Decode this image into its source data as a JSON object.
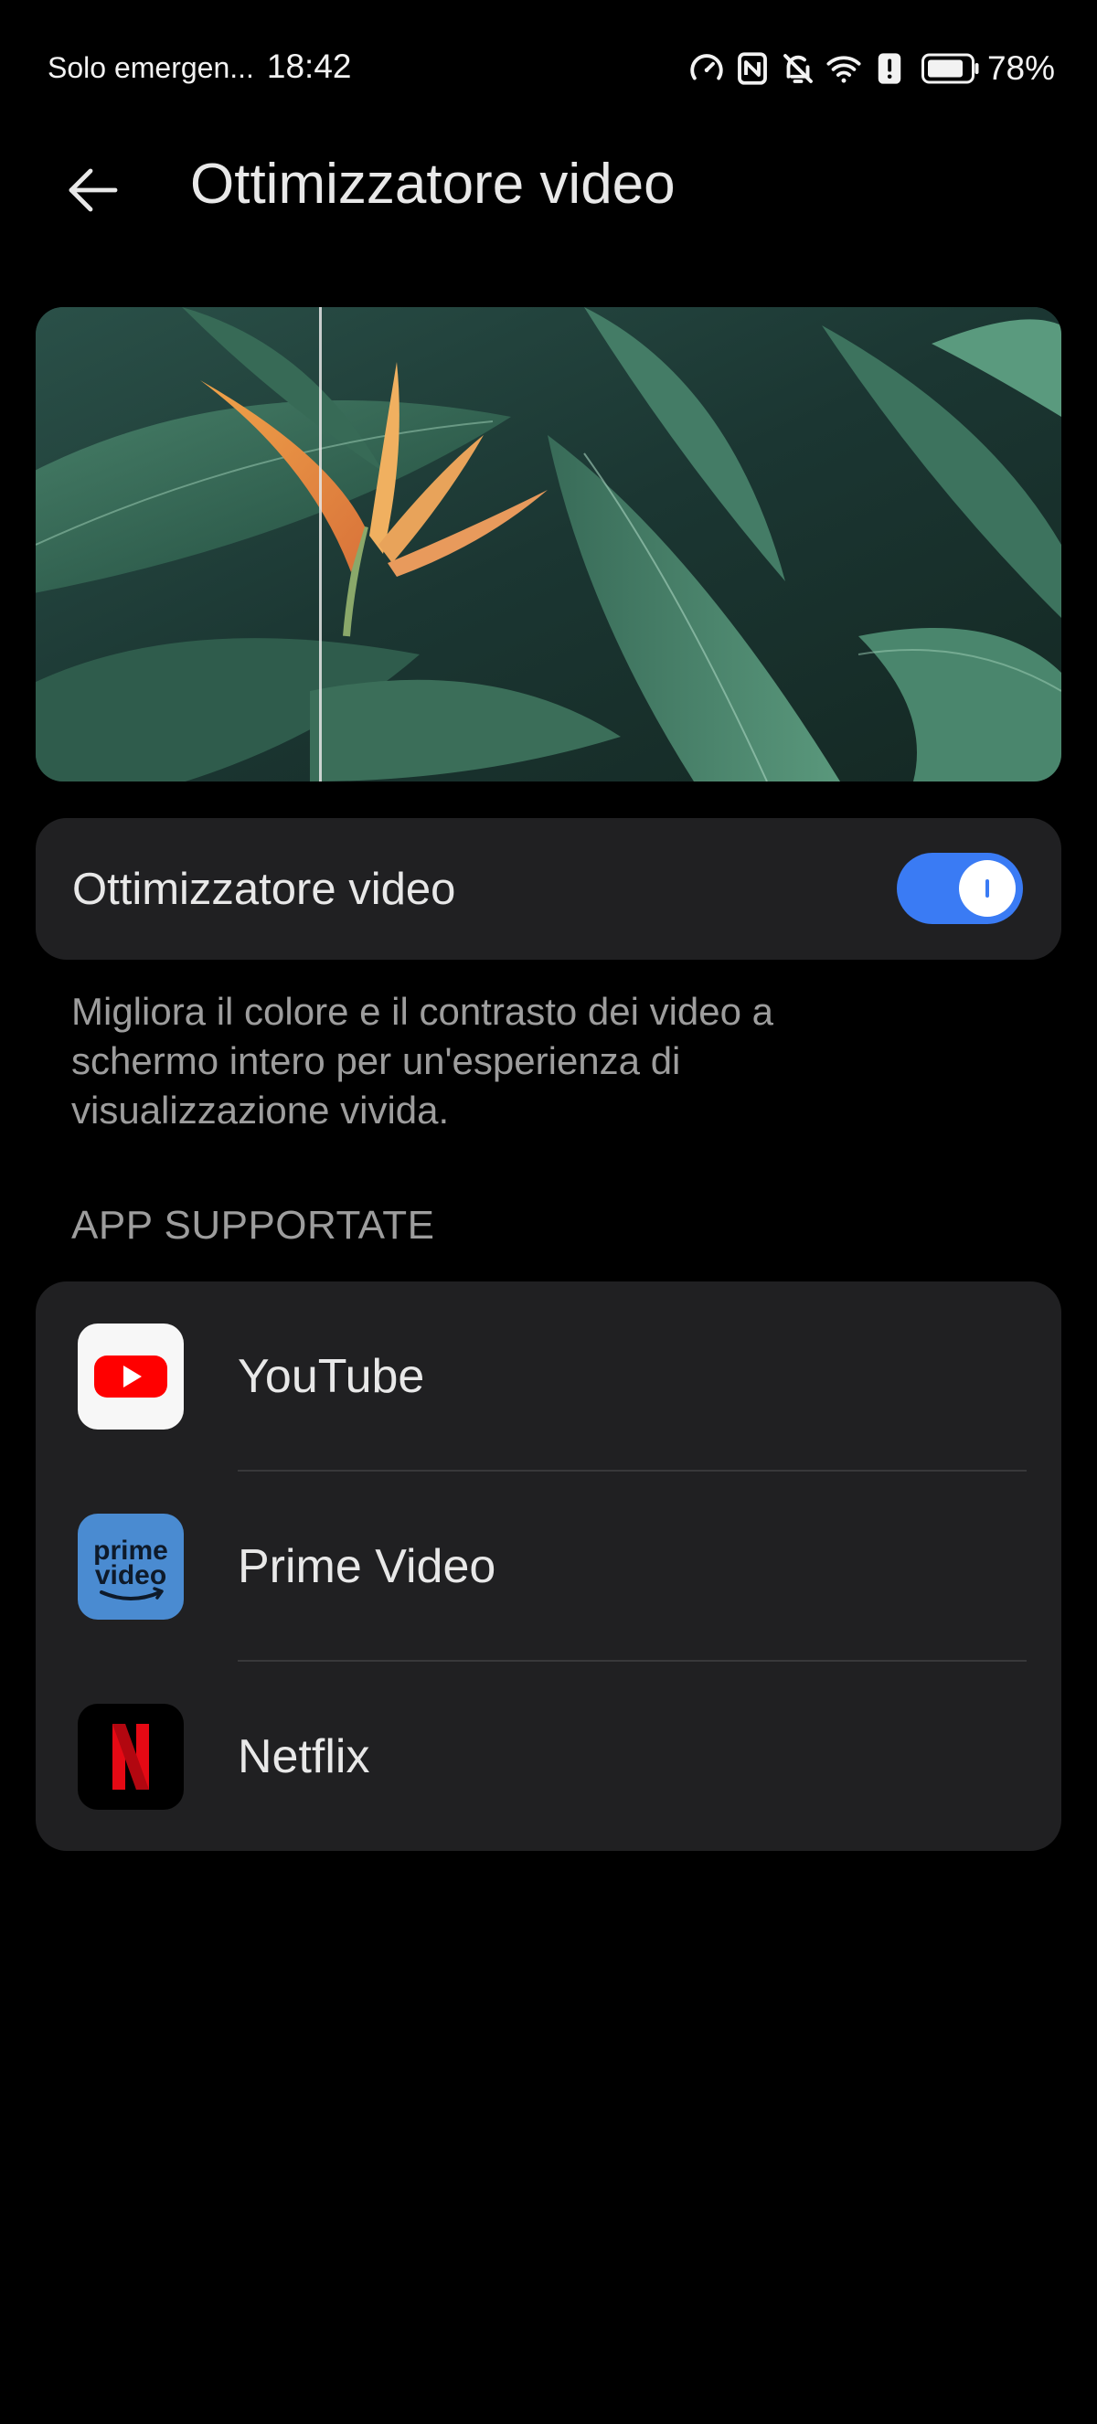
{
  "status_bar": {
    "carrier": "Solo emergen...",
    "time": "18:42",
    "battery_percent": "78%",
    "battery_level": 0.78,
    "icons": [
      "speed-icon",
      "nfc-icon",
      "bell-muted-icon",
      "wifi-icon",
      "alert-icon",
      "battery-icon"
    ]
  },
  "header": {
    "title": "Ottimizzatore video",
    "back_icon": "back-arrow-icon"
  },
  "preview": {
    "description_image": "tropical leaves with bird of paradise flower, before/after split"
  },
  "toggle": {
    "label": "Ottimizzatore video",
    "enabled": true,
    "accent_color": "#3a7bf4"
  },
  "description": "Migliora il colore e il contrasto dei video a schermo intero per un'esperienza di visualizzazione vivida.",
  "apps_section": {
    "header": "APP SUPPORTATE",
    "apps": [
      {
        "name": "YouTube",
        "icon": "youtube-icon"
      },
      {
        "name": "Prime Video",
        "icon": "prime-video-icon"
      },
      {
        "name": "Netflix",
        "icon": "netflix-icon"
      }
    ]
  },
  "prime_icon_text": {
    "line1": "prime",
    "line2": "video"
  }
}
